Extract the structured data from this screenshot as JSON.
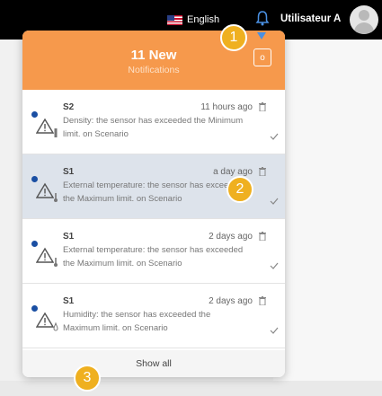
{
  "topbar": {
    "language": "English",
    "user_name": "Utilisateur A",
    "icons": [
      "flag-icon",
      "bell-icon",
      "avatar"
    ]
  },
  "notifications_panel": {
    "count_title": "11 New",
    "subtitle": "Notifications",
    "header_button_label": "o",
    "items": [
      {
        "title": "S2",
        "time": "11 hours ago",
        "message": "Density: the sensor has exceeded the Minimum limit. on Scenario",
        "selected": false,
        "sensor_icon": "density-icon"
      },
      {
        "title": "S1",
        "time": "a day ago",
        "message": "External temperature: the sensor has exceeded the Maximum limit. on Scenario",
        "selected": true,
        "sensor_icon": "thermometer-icon"
      },
      {
        "title": "S1",
        "time": "2 days ago",
        "message": "External temperature: the sensor has exceeded the Maximum limit. on Scenario",
        "selected": false,
        "sensor_icon": "thermometer-icon"
      },
      {
        "title": "S1",
        "time": "2 days ago",
        "message": "Humidity: the sensor has exceeded the Maximum limit. on Scenario",
        "selected": false,
        "sensor_icon": "droplet-icon"
      }
    ],
    "show_all_label": "Show all"
  },
  "callouts": [
    "1",
    "2",
    "3"
  ],
  "colors": {
    "header": "#f6994c",
    "topbar": "#000000",
    "callout": "#efb020",
    "unread_dot": "#1a4fa3",
    "selected_row": "#dde3eb"
  }
}
